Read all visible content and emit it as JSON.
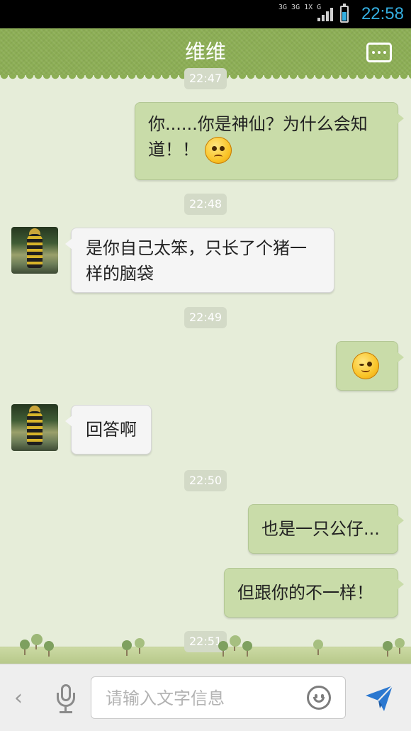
{
  "status_bar": {
    "network": "3G 3G 1X G",
    "time": "22:58"
  },
  "header": {
    "title": "维维",
    "menu_icon": "more-dots-icon"
  },
  "messages": [
    {
      "type": "time",
      "text": "22:47"
    },
    {
      "type": "message",
      "side": "right",
      "text": "你......你是神仙？为什么会知道！！",
      "emoji": "worried-face"
    },
    {
      "type": "time",
      "text": "22:48"
    },
    {
      "type": "message",
      "side": "left",
      "text": "是你自己太笨，只长了个猪一样的脑袋"
    },
    {
      "type": "time",
      "text": "22:49"
    },
    {
      "type": "message",
      "side": "right",
      "text": "",
      "emoji": "squinting-face"
    },
    {
      "type": "message",
      "side": "left",
      "text": "回答啊"
    },
    {
      "type": "time",
      "text": "22:50"
    },
    {
      "type": "message",
      "side": "right",
      "text": "也是一只公仔..."
    },
    {
      "type": "message",
      "side": "right",
      "text": "但跟你的不一样！"
    },
    {
      "type": "time",
      "text": "22:51"
    }
  ],
  "input_bar": {
    "placeholder": "请输入文字信息",
    "icons": [
      "back-chevron-icon",
      "microphone-icon",
      "smiley-icon",
      "send-icon"
    ]
  },
  "colors": {
    "header": "#8cae55",
    "right_bubble": "#c9dca9",
    "left_bubble": "#f5f5f5",
    "chat_background": "#e6edd9",
    "status_time": "#34aee0",
    "send_icon": "#2b78d0"
  }
}
